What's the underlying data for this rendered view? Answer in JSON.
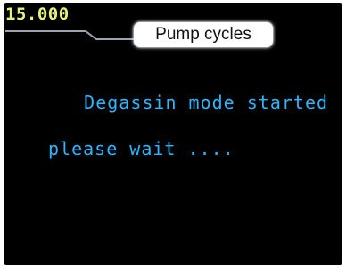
{
  "display": {
    "counter_value": "15.000",
    "message_line1": "Degassin mode started",
    "message_line2": "please wait ...."
  },
  "annotation": {
    "callout_label": "Pump cycles"
  },
  "colors": {
    "screen_background": "#000000",
    "counter_text": "#e6f27a",
    "message_text": "#2bb6ff",
    "callout_background": "#ffffff",
    "callout_text": "#111111"
  }
}
